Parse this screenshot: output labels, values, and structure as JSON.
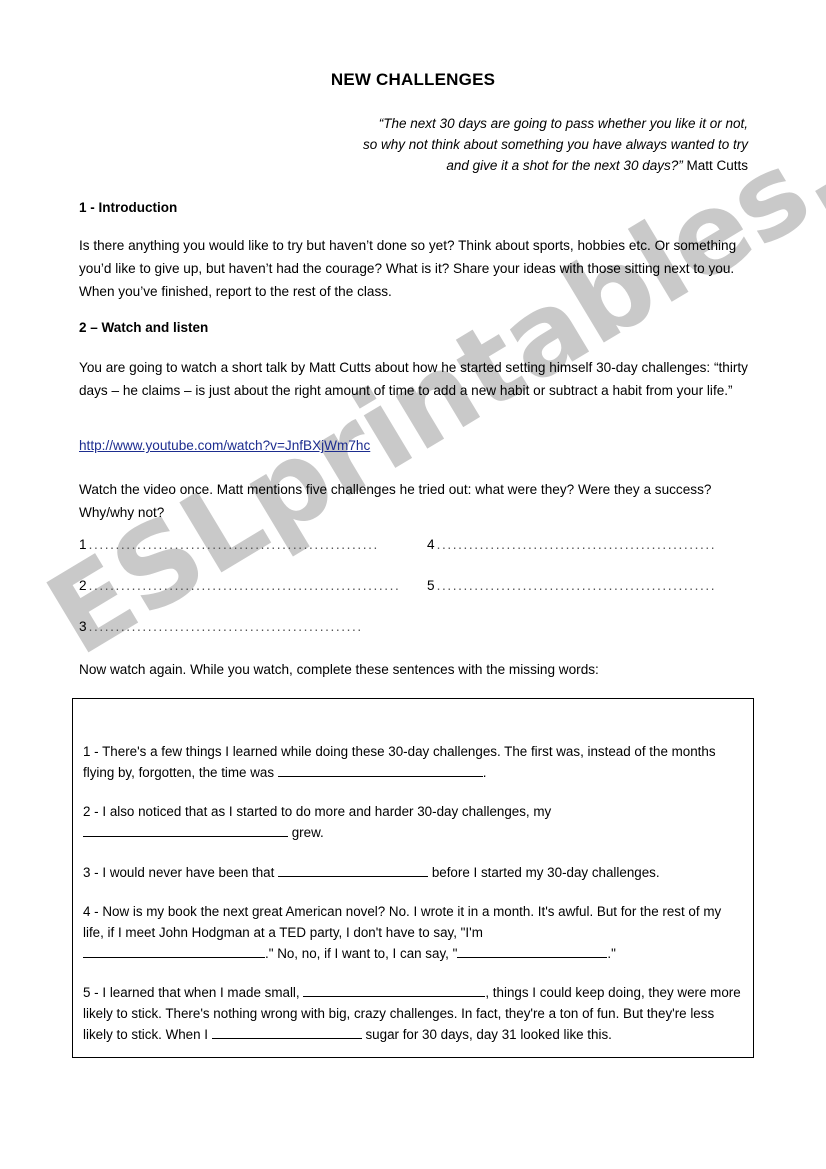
{
  "document": {
    "title": "NEW CHALLENGES",
    "watermark": "ESLprintables.com",
    "quote": {
      "line1": "“The next 30 days are going to pass whether you like it or not,",
      "line2": "so why not think about something you have always wanted to try",
      "line3": "and give it a shot for the next 30 days?”",
      "author": " Matt Cutts"
    },
    "link_color": "#1d2d8f",
    "watermark_color": "#c9c9c9"
  },
  "sections": {
    "introduction": {
      "heading": "1 - Introduction",
      "body": "Is there anything you would like to try but haven’t done so yet? Think about sports, hobbies etc. Or something you’d like to give up, but haven’t had the courage? What is it? Share your ideas with those sitting next to you. When you’ve finished, report to the rest of the class."
    },
    "watch_and_listen": {
      "heading": "2 – Watch and listen",
      "body": "You are going to watch a short talk by Matt Cutts about how he started setting himself 30-day challenges: “thirty days – he claims – is just about the right amount of time to add a new habit or subtract a habit from your life.”",
      "link": "http://www.youtube.com/watch?v=JnfBXjWm7hc",
      "instruction_first_watch": "Watch the video once. Matt mentions five challenges he tried out: what were they? Were they a success? Why/why not?",
      "instruction_second_watch": "Now watch again. While you watch, complete these sentences with the missing words:"
    }
  },
  "answer_lines": [
    {
      "number": "1",
      "dots": "........................................................"
    },
    {
      "number": "2",
      "dots": "............................................................."
    },
    {
      "number": "3",
      "dots": "..................................................."
    },
    {
      "number": "4",
      "dots": "....................................................."
    },
    {
      "number": "5",
      "dots": "....................................................."
    }
  ],
  "gap_fill": {
    "item1": {
      "label": "1 -",
      "text_a": "There's a few things I learned while doing these 30-day challenges. The first was, instead of the months flying by, forgotten, the time was",
      "text_b": "."
    },
    "item2": {
      "label": "2 -",
      "text_a": "I also noticed that as I started to do more and harder 30-day challenges, my",
      "text_b": "grew."
    },
    "item3": {
      "label": "3 -",
      "text_a": "I would never have been that",
      "text_b": "before I started my 30-day challenges."
    },
    "item4": {
      "label": "4 -",
      "text_a": "Now is my book the next great American novel? No. I wrote it in a month. It's awful. But for the rest of my life, if I meet John Hodgman at a TED party, I don't have to say, \"I'm",
      "text_b": ".\" No, no, if I want to, I can say, \"",
      "text_c": ".\""
    },
    "item5": {
      "label": "5 -",
      "text_a": "I learned that when I made small,",
      "text_b": ", things I could keep doing, they were more likely to stick. There's nothing wrong with big, crazy challenges. In fact, they're a ton of fun. But they're less likely to stick. When I",
      "text_c": "sugar for 30 days, day 31 looked like this."
    }
  }
}
